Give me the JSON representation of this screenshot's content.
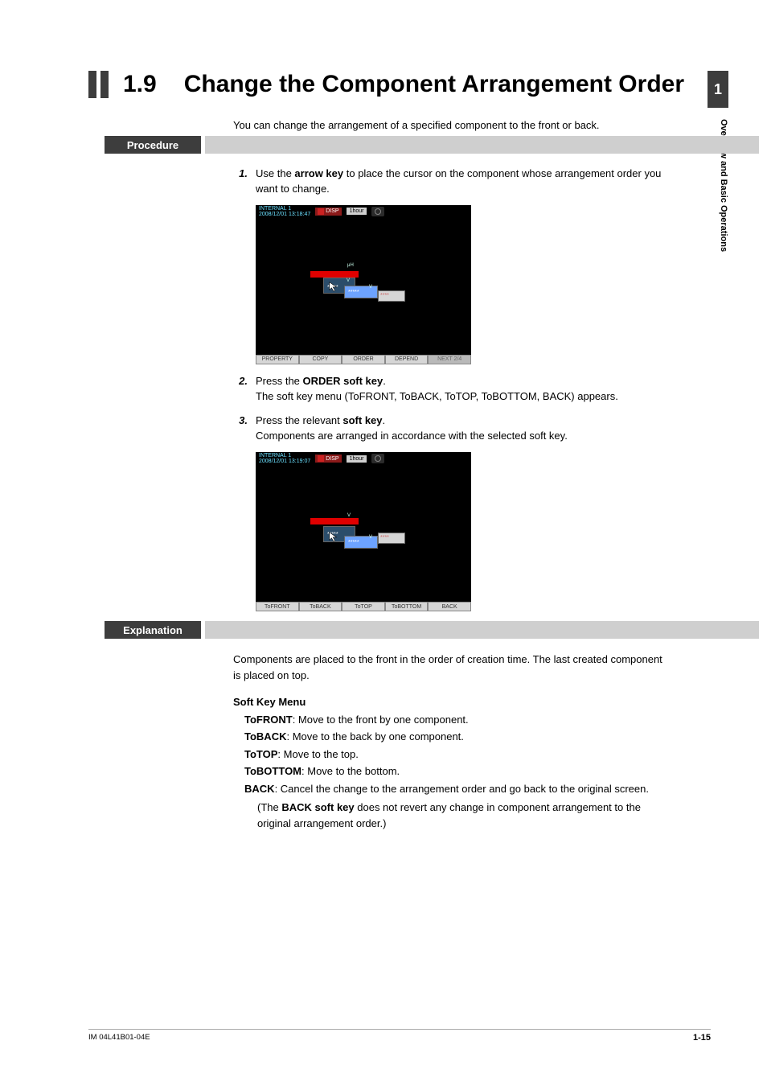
{
  "sideTab": {
    "chapter": "1",
    "label": "Overview and Basic Operations"
  },
  "title": {
    "num": "1.9",
    "text": "Change the Component Arrangement Order"
  },
  "intro": "You can change the arrangement of a specified component to the front or back.",
  "sections": {
    "procedure": "Procedure",
    "explanation": "Explanation"
  },
  "steps": {
    "s1": {
      "num": "1.",
      "pre": "Use the ",
      "bold": "arrow key",
      "post": " to place the cursor on the component whose arrangement order you want to change."
    },
    "s2": {
      "num": "2.",
      "pre": "Press the ",
      "bold": "ORDER soft key",
      "post": ".",
      "sub": "The soft key menu (ToFRONT, ToBACK, ToTOP, ToBOTTOM, BACK) appears."
    },
    "s3": {
      "num": "3.",
      "pre": "Press the relevant ",
      "bold": "soft key",
      "post": ".",
      "sub": "Components are arranged in accordance with the selected soft key."
    }
  },
  "screen1": {
    "hdr1": "INTERNAL 1",
    "hdr2": "2008/12/01 13:18:47",
    "disp": "DISP",
    "hour": "1hour",
    "keys": [
      "PROPERTY",
      "COPY",
      "ORDER",
      "DEPEND",
      "NEXT 2/4"
    ]
  },
  "screen2": {
    "hdr1": "INTERNAL 1",
    "hdr2": "2008/12/01 13:19:07",
    "disp": "DISP",
    "hour": "1hour",
    "keys": [
      "ToFRONT",
      "ToBACK",
      "ToTOP",
      "ToBOTTOM",
      "BACK"
    ]
  },
  "explanation": {
    "intro": "Components are placed to the front in the order of creation time. The last created component is placed on top.",
    "menuHead": "Soft Key Menu",
    "items": {
      "toFront": {
        "name": "ToFRONT",
        "desc": ": Move to the front by one component."
      },
      "toBack": {
        "name": "ToBACK",
        "desc": ": Move to the back by one component."
      },
      "toTop": {
        "name": "ToTOP",
        "desc": ": Move to the top."
      },
      "toBottom": {
        "name": "ToBOTTOM",
        "desc": ": Move to the bottom."
      },
      "back": {
        "name": "BACK",
        "desc": ": Cancel the change to the arrangement order and go back to the original screen."
      }
    },
    "note": {
      "pre": "(The ",
      "bold": "BACK soft key",
      "post": " does not revert any change in component arrangement to the original arrangement order.)"
    }
  },
  "footer": {
    "left": "IM 04L41B01-04E",
    "right": "1-15"
  }
}
